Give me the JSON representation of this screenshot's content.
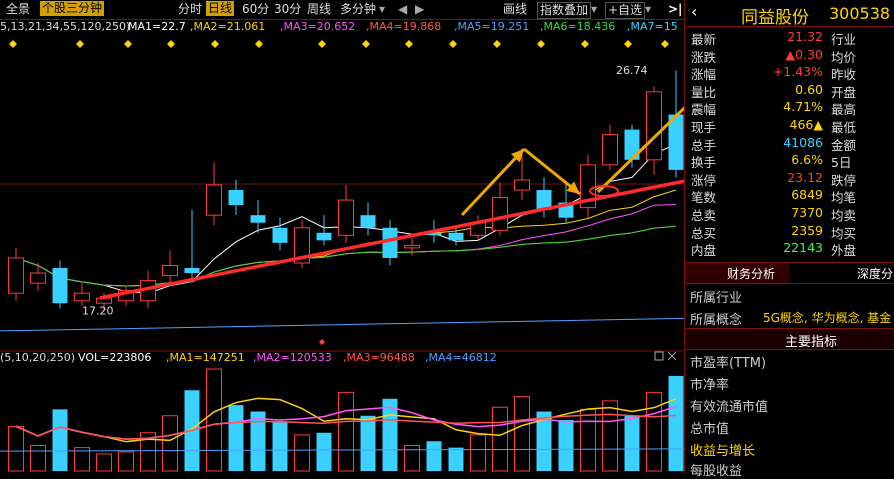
{
  "toolbar": {
    "full_view": "全景",
    "stock_3min": "个股三分钟",
    "fenshi": "分时",
    "daily": "日线",
    "m60": "60分",
    "m30": "30分",
    "weekly": "周线",
    "multi_period": "多分钟",
    "draw": "画线",
    "index_overlay": "指数叠加",
    "watchlist": "+自选"
  },
  "ma_line": {
    "params": "5,13,21,34,55,120,250)",
    "ma1": "MA1=22.7",
    "ma2": ",MA2=21.061",
    "ma3": ",MA3=20.652",
    "ma4": ",MA4=19.868",
    "ma5": ",MA5=19.251",
    "ma6": ",MA6=18.436",
    "ma7": ",MA7=15"
  },
  "vol_line": {
    "params": "(5,10,20,250)",
    "vol": "VOL=223806",
    "ma1": ",MA1=147251",
    "ma2": ",MA2=120533",
    "ma3": ",MA3=96488",
    "ma4": ",MA4=46812"
  },
  "stock": {
    "name": "同益股份",
    "code": "300538"
  },
  "quote_rows": [
    {
      "k": "最新",
      "v": "21.32",
      "c": "#ff3b3b",
      "k2": "行业"
    },
    {
      "k": "涨跌",
      "v": "▲0.30",
      "c": "#ff3b3b",
      "k2": "均价"
    },
    {
      "k": "涨幅",
      "v": "+1.43%",
      "c": "#ff3b3b",
      "k2": "昨收"
    },
    {
      "k": "量比",
      "v": "0.60",
      "c": "#ffd400",
      "k2": "开盘"
    },
    {
      "k": "震幅",
      "v": "4.71%",
      "c": "#ffd400",
      "k2": "最高"
    },
    {
      "k": "现手",
      "v": "466▲",
      "c": "#ffd400",
      "k2": "最低"
    },
    {
      "k": "总手",
      "v": "41086",
      "c": "#3ad0ff",
      "k2": "金额"
    },
    {
      "k": "换手",
      "v": "6.6%",
      "c": "#ffd400",
      "k2": "5日"
    },
    {
      "k": "涨停",
      "v": "23.12",
      "c": "#ff3b3b",
      "k2": "跌停"
    },
    {
      "k": "笔数",
      "v": "6849",
      "c": "#ffd400",
      "k2": "均笔"
    },
    {
      "k": "总卖",
      "v": "7370",
      "c": "#ffd400",
      "k2": "均卖"
    },
    {
      "k": "总买",
      "v": "2359",
      "c": "#ffd400",
      "k2": "均买"
    },
    {
      "k": "内盘",
      "v": "22143",
      "c": "#33ff33",
      "k2": "外盘"
    }
  ],
  "tabs": {
    "finance": "财务分析",
    "depth": "深度分"
  },
  "profile": {
    "industry_label": "所属行业",
    "concept_label": "所属概念",
    "concept_value": "5G概念, 华为概念, 基金",
    "main_indicators": "主要指标",
    "pe": "市盈率(TTM)",
    "pb": "市净率",
    "float_cap": "有效流通市值",
    "total_cap": "总市值",
    "growth": "收益与增长",
    "eps": "每股收益"
  },
  "chart_data": {
    "type": "candlestick",
    "price_ylim": [
      16.0,
      28.0
    ],
    "max_label": "26.74",
    "min_label": "17.20",
    "candles": [
      {
        "o": 17.9,
        "c": 19.3,
        "h": 19.7,
        "l": 17.6
      },
      {
        "o": 18.3,
        "c": 18.7,
        "h": 19.1,
        "l": 18.0
      },
      {
        "o": 18.9,
        "c": 17.5,
        "h": 19.2,
        "l": 17.3
      },
      {
        "o": 17.6,
        "c": 17.9,
        "h": 18.3,
        "l": 17.4
      },
      {
        "o": 17.5,
        "c": 17.7,
        "h": 17.9,
        "l": 17.2
      },
      {
        "o": 17.6,
        "c": 18.0,
        "h": 18.2,
        "l": 17.4
      },
      {
        "o": 17.6,
        "c": 18.4,
        "h": 18.8,
        "l": 17.3
      },
      {
        "o": 18.6,
        "c": 19.0,
        "h": 19.6,
        "l": 18.3
      },
      {
        "o": 18.9,
        "c": 18.7,
        "h": 21.2,
        "l": 18.5
      },
      {
        "o": 21.0,
        "c": 22.2,
        "h": 23.1,
        "l": 20.6
      },
      {
        "o": 22.0,
        "c": 21.4,
        "h": 22.4,
        "l": 21.0
      },
      {
        "o": 21.0,
        "c": 20.7,
        "h": 21.6,
        "l": 20.3
      },
      {
        "o": 20.5,
        "c": 19.9,
        "h": 20.9,
        "l": 19.6
      },
      {
        "o": 19.1,
        "c": 20.5,
        "h": 20.8,
        "l": 18.9
      },
      {
        "o": 20.3,
        "c": 20.0,
        "h": 21.0,
        "l": 19.8
      },
      {
        "o": 20.2,
        "c": 21.6,
        "h": 22.2,
        "l": 19.9
      },
      {
        "o": 21.0,
        "c": 20.5,
        "h": 21.5,
        "l": 20.2
      },
      {
        "o": 20.5,
        "c": 19.3,
        "h": 20.8,
        "l": 19.0
      },
      {
        "o": 19.7,
        "c": 19.8,
        "h": 20.1,
        "l": 19.4
      },
      {
        "o": 20.3,
        "c": 20.2,
        "h": 20.8,
        "l": 19.9
      },
      {
        "o": 20.3,
        "c": 20.0,
        "h": 20.6,
        "l": 19.8
      },
      {
        "o": 20.2,
        "c": 20.7,
        "h": 21.0,
        "l": 20.0
      },
      {
        "o": 20.4,
        "c": 21.7,
        "h": 22.3,
        "l": 20.2
      },
      {
        "o": 22.0,
        "c": 22.4,
        "h": 23.5,
        "l": 21.6
      },
      {
        "o": 22.0,
        "c": 21.2,
        "h": 22.5,
        "l": 20.9
      },
      {
        "o": 21.5,
        "c": 20.9,
        "h": 22.3,
        "l": 20.7
      },
      {
        "o": 21.3,
        "c": 23.0,
        "h": 23.4,
        "l": 20.9
      },
      {
        "o": 23.0,
        "c": 24.2,
        "h": 24.6,
        "l": 22.8
      },
      {
        "o": 24.4,
        "c": 23.2,
        "h": 24.6,
        "l": 22.9
      },
      {
        "o": 23.2,
        "c": 25.9,
        "h": 26.1,
        "l": 22.6
      },
      {
        "o": 25.0,
        "c": 22.8,
        "h": 26.74,
        "l": 22.5
      }
    ],
    "volume": [
      105000,
      60000,
      145000,
      55000,
      40000,
      45000,
      90000,
      130000,
      190000,
      240000,
      155000,
      140000,
      115000,
      85000,
      90000,
      185000,
      130000,
      170000,
      60000,
      70000,
      55000,
      85000,
      150000,
      175000,
      140000,
      120000,
      145000,
      165000,
      130000,
      185000,
      223806
    ],
    "vol_ylim": [
      0,
      240000
    ]
  }
}
